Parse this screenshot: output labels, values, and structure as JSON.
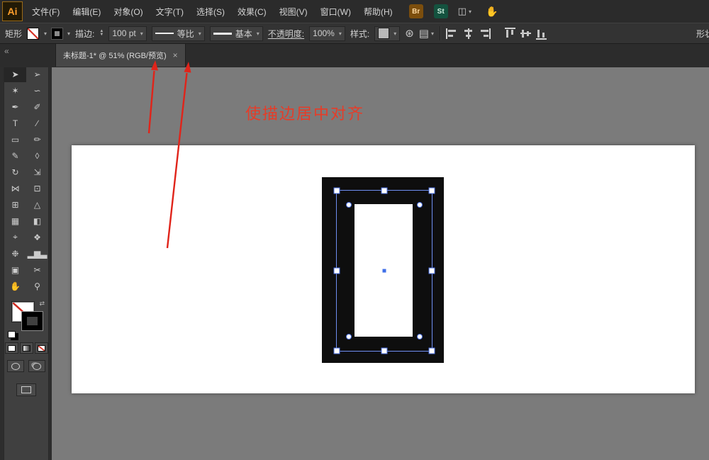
{
  "menubar": {
    "logo": "Ai",
    "items": [
      "文件(F)",
      "编辑(E)",
      "对象(O)",
      "文字(T)",
      "选择(S)",
      "效果(C)",
      "视图(V)",
      "窗口(W)",
      "帮助(H)"
    ],
    "bridge_label": "Br",
    "stock_label": "St"
  },
  "controlbar": {
    "context_label": "矩形",
    "stroke_label": "描边:",
    "stroke_value": "100 pt",
    "stroke_profile": "等比",
    "brush_definition": "基本",
    "opacity_label": "不透明度:",
    "opacity_value": "100%",
    "style_label": "样式:",
    "shape_label": "形状"
  },
  "tabbar": {
    "tab_title": "未标题-1* @ 51% (RGB/预览)",
    "close_icon": "×",
    "collapse_icon": "«"
  },
  "annotation": {
    "text": "使描边居中对齐"
  },
  "icons": {
    "combo_chevron": "▾",
    "stepper_up": "▲",
    "stepper_down": "▼",
    "workspace": "◫",
    "touch": "✋",
    "recolor": "⊛",
    "arrange_docs": "▤",
    "swap": "⇄"
  },
  "tools": [
    {
      "name": "selection-tool",
      "glyph": "➤"
    },
    {
      "name": "direct-selection-tool",
      "glyph": "➢"
    },
    {
      "name": "magic-wand-tool",
      "glyph": "✶"
    },
    {
      "name": "lasso-tool",
      "glyph": "∽"
    },
    {
      "name": "pen-tool",
      "glyph": "✒"
    },
    {
      "name": "curvature-tool",
      "glyph": "✐"
    },
    {
      "name": "type-tool",
      "glyph": "T"
    },
    {
      "name": "line-segment-tool",
      "glyph": "∕"
    },
    {
      "name": "rectangle-tool",
      "glyph": "▭"
    },
    {
      "name": "paintbrush-tool",
      "glyph": "✏"
    },
    {
      "name": "shaper-tool",
      "glyph": "✎"
    },
    {
      "name": "eraser-tool",
      "glyph": "◊"
    },
    {
      "name": "rotate-tool",
      "glyph": "↻"
    },
    {
      "name": "scale-tool",
      "glyph": "⇲"
    },
    {
      "name": "width-tool",
      "glyph": "⋈"
    },
    {
      "name": "free-transform-tool",
      "glyph": "⊡"
    },
    {
      "name": "shape-builder-tool",
      "glyph": "⊞"
    },
    {
      "name": "perspective-grid-tool",
      "glyph": "△"
    },
    {
      "name": "mesh-tool",
      "glyph": "▦"
    },
    {
      "name": "gradient-tool",
      "glyph": "◧"
    },
    {
      "name": "eyedropper-tool",
      "glyph": "⌖"
    },
    {
      "name": "blend-tool",
      "glyph": "❖"
    },
    {
      "name": "symbol-sprayer-tool",
      "glyph": "❉"
    },
    {
      "name": "column-graph-tool",
      "glyph": "▂▆▃"
    },
    {
      "name": "artboard-tool",
      "glyph": "▣"
    },
    {
      "name": "slice-tool",
      "glyph": "✂"
    },
    {
      "name": "hand-tool",
      "glyph": "✋"
    },
    {
      "name": "zoom-tool",
      "glyph": "⚲"
    }
  ],
  "colors": {
    "selection_blue": "#4a6fe0",
    "annotation_red": "#e0241a",
    "frame_black": "#0e0e0e",
    "canvas_gray": "#7b7b7b"
  }
}
